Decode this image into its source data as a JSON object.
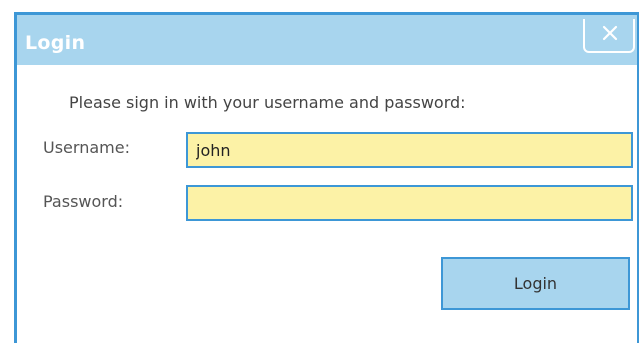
{
  "dialog": {
    "title": "Login",
    "close_icon": "close-icon",
    "prompt": "Please sign in with your username and password:"
  },
  "form": {
    "username_label": "Username:",
    "username_value": "john",
    "password_label": "Password:",
    "password_value": ""
  },
  "actions": {
    "login_label": "Login"
  },
  "colors": {
    "accent": "#3d97d6",
    "titlebar": "#a8d5ee",
    "field_background": "#fcf2a6"
  }
}
